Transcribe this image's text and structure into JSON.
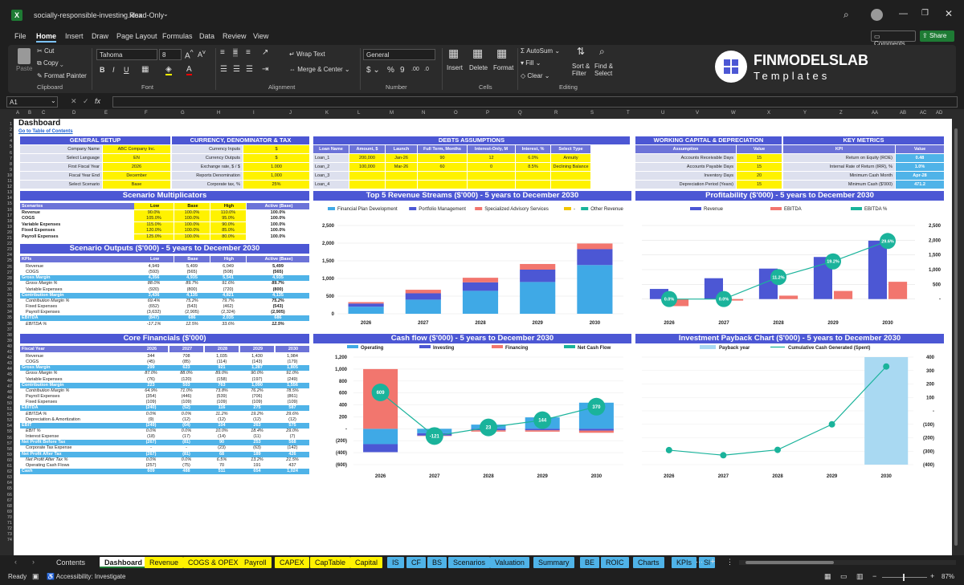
{
  "window": {
    "filename": "socially-responsible-investing.xlsx",
    "mode": "Read-Only",
    "comments": "Comments",
    "share": "Share"
  },
  "menu": [
    "File",
    "Home",
    "Insert",
    "Draw",
    "Page Layout",
    "Formulas",
    "Data",
    "Review",
    "View"
  ],
  "ribbon": {
    "paste": "Paste",
    "cut": "Cut",
    "copy": "Copy",
    "format_painter": "Format Painter",
    "clipboard": "Clipboard",
    "font_name": "Tahoma",
    "font_size": "8",
    "font": "Font",
    "wrap_text": "Wrap Text",
    "merge_center": "Merge & Center",
    "alignment": "Alignment",
    "number_format": "General",
    "number": "Number",
    "insert": "Insert",
    "delete": "Delete",
    "format": "Format",
    "cells": "Cells",
    "autosum": "AutoSum",
    "fill": "Fill",
    "clear": "Clear",
    "sort_filter": "Sort & Filter",
    "find_select": "Find & Select",
    "editing": "Editing",
    "brand_main": "FINMODELSLAB",
    "brand_sub": "Templates"
  },
  "formula": {
    "cell_ref": "A1",
    "fx": "fx"
  },
  "columns": [
    "A",
    "B",
    "C",
    "D",
    "E",
    "F",
    "G",
    "H",
    "I",
    "J",
    "K",
    "L",
    "M",
    "N",
    "O",
    "P",
    "Q",
    "R",
    "S",
    "T",
    "U",
    "V",
    "W",
    "X",
    "Y",
    "Z",
    "AA",
    "AB",
    "AC",
    "AD"
  ],
  "rows": [
    "1",
    "2",
    "3",
    "4",
    "5",
    "6",
    "7",
    "8",
    "9",
    "10",
    "11",
    "12",
    "13",
    "14",
    "15",
    "16",
    "17",
    "18",
    "19",
    "20",
    "21",
    "22",
    "23",
    "24",
    "25",
    "26",
    "27",
    "28",
    "29",
    "30",
    "31",
    "32",
    "33",
    "34",
    "35",
    "36",
    "37",
    "38",
    "39",
    "40",
    "41",
    "42",
    "43",
    "44",
    "45",
    "46",
    "47",
    "48",
    "49",
    "50",
    "51",
    "52",
    "53",
    "54",
    "55",
    "56",
    "57",
    "58",
    "59",
    "60",
    "61",
    "62",
    "63",
    "64",
    "65",
    "66",
    "67",
    "68",
    "69",
    "70",
    "71",
    "72",
    "73",
    "74"
  ],
  "sheet": {
    "title": "Dashboard",
    "toc_link": "Go to Table of Contents",
    "general_setup": {
      "header": "GENERAL SETUP",
      "items": [
        {
          "label": "Company Name",
          "value": "ABC Company Inc."
        },
        {
          "label": "Select Language",
          "value": "EN"
        },
        {
          "label": "First Fiscal Year",
          "value": "2026"
        },
        {
          "label": "Fiscal Year End",
          "value": "December"
        },
        {
          "label": "Select Scenario",
          "value": "Base"
        }
      ]
    },
    "currency": {
      "header": "CURRENCY, DENOMINATOR & TAX",
      "items": [
        {
          "label": "Currency Inputs",
          "value": "$"
        },
        {
          "label": "Currency Outputs",
          "value": "$"
        },
        {
          "label": "Exchange rate, $ / $",
          "value": "1.000"
        },
        {
          "label": "Reports Denomination",
          "value": "1,000"
        },
        {
          "label": "Corporate tax, %",
          "value": "25%"
        }
      ]
    },
    "debts": {
      "header": "DEBTS ASSUMPTIONS",
      "columns": [
        "Loan Name",
        "Amount, $",
        "Launch",
        "Full Term, Months",
        "Interest-Only, M",
        "Interest, %",
        "Select Type"
      ],
      "rows": [
        [
          "Loan_1",
          "200,000",
          "Jan-26",
          "90",
          "12",
          "6.0%",
          "Annuity"
        ],
        [
          "Loan_2",
          "100,000",
          "Mar-26",
          "60",
          "0",
          "8.5%",
          "Declining Balance"
        ],
        [
          "Loan_3",
          "",
          "",
          "",
          "",
          "",
          ""
        ],
        [
          "Loan_4",
          "",
          "",
          "",
          "",
          "",
          ""
        ]
      ]
    },
    "working_capital": {
      "header": "WORKING CAPITAL & DEPRECIATION",
      "col1": "Assumption",
      "col2": "Value",
      "items": [
        {
          "label": "Accounts Receivable Days",
          "value": "15"
        },
        {
          "label": "Accounts Payable Days",
          "value": "15"
        },
        {
          "label": "Inventory Days",
          "value": "20"
        },
        {
          "label": "Depreciation Period (Years)",
          "value": "15"
        }
      ]
    },
    "key_metrics": {
      "header": "KEY METRICS",
      "col1": "KPI",
      "col2": "Value",
      "items": [
        {
          "label": "Return on Equity (ROE)",
          "value": "0.48"
        },
        {
          "label": "Internal Rate of Return (IRR), %",
          "value": "1.0%"
        },
        {
          "label": "Minimum Cash Month",
          "value": "Apr-28"
        },
        {
          "label": "Minimum Cash ($'000)",
          "value": "471.2"
        }
      ]
    },
    "scenario_mult": {
      "header": "Scenario Multiplicators",
      "columns": [
        "Scenarios",
        "Low",
        "Base",
        "High",
        "Active (Base)"
      ],
      "rows": [
        [
          "Revenue",
          "90.0%",
          "100.0%",
          "110.0%",
          "100.0%"
        ],
        [
          "COGS",
          "105.0%",
          "100.0%",
          "95.0%",
          "100.0%"
        ],
        [
          "Variable Expenses",
          "115.0%",
          "100.0%",
          "90.0%",
          "100.0%"
        ],
        [
          "Fixed Expenses",
          "120.0%",
          "100.0%",
          "85.0%",
          "100.0%"
        ],
        [
          "Payroll Expenses",
          "125.0%",
          "100.0%",
          "80.0%",
          "100.0%"
        ]
      ]
    },
    "scenario_out": {
      "header": "Scenario Outputs ($'000) - 5 years to December 2030",
      "columns": [
        "KPIs",
        "Low",
        "Base",
        "High",
        "Active (Base)"
      ],
      "rows": [
        {
          "k": "Revenue",
          "v": [
            "4,949",
            "5,499",
            "6,049",
            "5,499"
          ],
          "t": "n"
        },
        {
          "k": "COGS",
          "v": [
            "(593)",
            "(565)",
            "(508)",
            "(565)"
          ],
          "t": "n"
        },
        {
          "k": "Gross Margin",
          "v": [
            "4,356",
            "4,935",
            "5,541",
            "4,935"
          ],
          "t": "h"
        },
        {
          "k": "Gross Margin %",
          "v": [
            "88.0%",
            "89.7%",
            "91.6%",
            "89.7%"
          ],
          "t": "i"
        },
        {
          "k": "Variable Expenses",
          "v": [
            "(920)",
            "(800)",
            "(720)",
            "(800)"
          ],
          "t": "n"
        },
        {
          "k": "Contribution Margin",
          "v": [
            "3,436",
            "4,135",
            "4,821",
            "4,135"
          ],
          "t": "h"
        },
        {
          "k": "Contribution Margin %",
          "v": [
            "69.4%",
            "75.2%",
            "79.7%",
            "75.2%"
          ],
          "t": "i"
        },
        {
          "k": "Fixed Expenses",
          "v": [
            "(652)",
            "(543)",
            "(462)",
            "(543)"
          ],
          "t": "n"
        },
        {
          "k": "Payroll Expenses",
          "v": [
            "(3,632)",
            "(2,905)",
            "(2,324)",
            "(2,905)"
          ],
          "t": "n"
        },
        {
          "k": "EBITDA",
          "v": [
            "(847)",
            "686",
            "2,035",
            "686"
          ],
          "t": "h"
        },
        {
          "k": "EBITDA %",
          "v": [
            "-17.1%",
            "12.5%",
            "33.6%",
            "12.5%"
          ],
          "t": "i"
        }
      ]
    },
    "core": {
      "header": "Core Financials ($'000)",
      "columns": [
        "Fiscal Year",
        "2026",
        "2027",
        "2028",
        "2029",
        "2030"
      ],
      "rows": [
        {
          "k": "Revenue",
          "v": [
            "344",
            "708",
            "1,035",
            "1,430",
            "1,984"
          ],
          "t": "n"
        },
        {
          "k": "COGS",
          "v": [
            "(45)",
            "(85)",
            "(114)",
            "(143)",
            "(179)"
          ],
          "t": "n"
        },
        {
          "k": "Gross Margin",
          "v": [
            "299",
            "623",
            "921",
            "1,287",
            "1,805"
          ],
          "t": "h"
        },
        {
          "k": "Gross Margin %",
          "v": [
            "87.0%",
            "88.0%",
            "89.0%",
            "90.0%",
            "91.0%"
          ],
          "t": "i"
        },
        {
          "k": "Variable Expenses",
          "v": [
            "(76)",
            "(120)",
            "(158)",
            "(197)",
            "(249)"
          ],
          "t": "n"
        },
        {
          "k": "Contribution Margin",
          "v": [
            "223",
            "503",
            "763",
            "1,090",
            "1,556"
          ],
          "t": "h"
        },
        {
          "k": "Contribution Margin %",
          "v": [
            "64.9%",
            "71.0%",
            "73.8%",
            "76.2%",
            "78.5%"
          ],
          "t": "i"
        },
        {
          "k": "Payroll Expenses",
          "v": [
            "(354)",
            "(446)",
            "(539)",
            "(706)",
            "(861)"
          ],
          "t": "n"
        },
        {
          "k": "Fixed Expenses",
          "v": [
            "(109)",
            "(109)",
            "(109)",
            "(109)",
            "(109)"
          ],
          "t": "n"
        },
        {
          "k": "EBITDA",
          "v": [
            "(240)",
            "(52)",
            "116",
            "275",
            "587"
          ],
          "t": "h"
        },
        {
          "k": "EBITDA %",
          "v": [
            "0.0%",
            "0.0%",
            "11.2%",
            "19.2%",
            "29.6%"
          ],
          "t": "i"
        },
        {
          "k": "Depreciation & Amortization",
          "v": [
            "(9)",
            "(12)",
            "(12)",
            "(12)",
            "(12)"
          ],
          "t": "n"
        },
        {
          "k": "EBIT",
          "v": [
            "(249)",
            "(64)",
            "104",
            "263",
            "575"
          ],
          "t": "h"
        },
        {
          "k": "EBIT %",
          "v": [
            "0.0%",
            "0.0%",
            "10.0%",
            "18.4%",
            "29.0%"
          ],
          "t": "i"
        },
        {
          "k": "Interest Expense",
          "v": [
            "(18)",
            "(17)",
            "(14)",
            "(11)",
            "(7)"
          ],
          "t": "n"
        },
        {
          "k": "Net Profit Before Tax",
          "v": [
            "(267)",
            "(81)",
            "90",
            "253",
            "568"
          ],
          "t": "h"
        },
        {
          "k": "Corporate Tax Expense",
          "v": [
            "-",
            "-",
            "(23)",
            "(63)",
            "(142)"
          ],
          "t": "n"
        },
        {
          "k": "Net Profit After Tax",
          "v": [
            "(267)",
            "(81)",
            "68",
            "189",
            "426"
          ],
          "t": "h"
        },
        {
          "k": "Net Profit After Tax %",
          "v": [
            "0.0%",
            "0.0%",
            "6.5%",
            "13.2%",
            "21.5%"
          ],
          "t": "i"
        },
        {
          "k": "Operating Cash Flows",
          "v": [
            "(257)",
            "(75)",
            "70",
            "191",
            "437"
          ],
          "t": "n"
        },
        {
          "k": "Cash",
          "v": [
            "609",
            "488",
            "511",
            "654",
            "1,024"
          ],
          "t": "h"
        }
      ]
    }
  },
  "charts": {
    "revenue": {
      "title": "Top 5 Revenue Streams ($'000) - 5 years to December 2030"
    },
    "profit": {
      "title": "Profitability ($'000) - 5 years to December 2030"
    },
    "cash": {
      "title": "Cash flow ($'000) - 5 years to December 2030"
    },
    "payback": {
      "title": "Investment Payback Chart ($'000) - 5 years to December 2030"
    }
  },
  "chart_data": [
    {
      "type": "bar",
      "title": "Top 5 Revenue Streams ($'000) - 5 years to December 2030",
      "categories": [
        "2026",
        "2027",
        "2028",
        "2029",
        "2030"
      ],
      "ylim": [
        0,
        2500
      ],
      "yticks": [
        "0",
        "500",
        "1,000",
        "1,500",
        "2,000",
        "2,500"
      ],
      "series": [
        {
          "name": "Financial Plan Development",
          "values": [
            200,
            400,
            650,
            900,
            1380
          ],
          "color": "#3fa9e6"
        },
        {
          "name": "Portfolio Management",
          "values": [
            90,
            180,
            240,
            350,
            450
          ],
          "color": "#4c57d4"
        },
        {
          "name": "Specialized Advisory Services",
          "values": [
            40,
            100,
            130,
            160,
            160
          ],
          "color": "#f2766e"
        },
        {
          "name": "-",
          "values": [
            0,
            0,
            0,
            0,
            0
          ],
          "color": "#f2c500"
        },
        {
          "name": "Other Revenue",
          "values": [
            0,
            0,
            0,
            0,
            0
          ],
          "color": "#1ab39b"
        }
      ]
    },
    {
      "type": "bar",
      "title": "Profitability ($'000) - 5 years to December 2030",
      "categories": [
        "2026",
        "2027",
        "2028",
        "2029",
        "2030"
      ],
      "ylim": [
        -500,
        2500
      ],
      "yticks": [
        "-",
        "500",
        "1,000",
        "1,500",
        "2,000",
        "2,500"
      ],
      "y2ticks": [
        "-",
        "5.0%",
        "10.0%",
        "15.0%",
        "20.0%",
        "25.0%",
        "30.0%"
      ],
      "series": [
        {
          "name": "Revenue",
          "values": [
            344,
            708,
            1035,
            1430,
            1984
          ],
          "color": "#4c57d4"
        },
        {
          "name": "EBITDA",
          "values": [
            -240,
            -52,
            116,
            275,
            587
          ],
          "color": "#f2766e"
        },
        {
          "name": "EBITDA %",
          "values": [
            0.0,
            0.0,
            11.2,
            19.2,
            29.6
          ],
          "labels": [
            "0.0%",
            "0.0%",
            "11.2%",
            "19.2%",
            "29.6%"
          ],
          "color": "#1ab39b"
        }
      ]
    },
    {
      "type": "bar",
      "title": "Cash flow ($'000) - 5 years to December 2030",
      "categories": [
        "2026",
        "2027",
        "2028",
        "2029",
        "2030"
      ],
      "ylim": [
        -600,
        1200
      ],
      "yticks": [
        "(600)",
        "(400)",
        "(200)",
        "-",
        "200",
        "400",
        "600",
        "800",
        "1,000",
        "1,200"
      ],
      "series": [
        {
          "name": "Operating",
          "values": [
            -257,
            -75,
            70,
            191,
            437
          ],
          "color": "#3fa9e6"
        },
        {
          "name": "Investing",
          "values": [
            -134,
            -40,
            -25,
            -25,
            -30
          ],
          "color": "#4c57d4"
        },
        {
          "name": "Financing",
          "values": [
            1000,
            -6,
            -22,
            -23,
            -37
          ],
          "color": "#f2766e"
        },
        {
          "name": "Net Cash Flow",
          "values": [
            609,
            -121,
            23,
            144,
            370
          ],
          "labels": [
            "609",
            "-121",
            "23",
            "144",
            "370"
          ],
          "color": "#1ab39b"
        }
      ]
    },
    {
      "type": "line",
      "title": "Investment Payback Chart ($'000) - 5 years to December 2030",
      "categories": [
        "2026",
        "2027",
        "2028",
        "2029",
        "2030"
      ],
      "ylim": [
        -400,
        400
      ],
      "yticks": [
        "(400)",
        "(300)",
        "(200)",
        "(100)",
        "-",
        "100",
        "200",
        "300",
        "400"
      ],
      "series": [
        {
          "name": "Payback year",
          "values": [
            0,
            0,
            0,
            0,
            1
          ],
          "color": "#a9d9f2"
        },
        {
          "name": "Cumulative Cash Generated (Spent)",
          "values": [
            -292,
            -330,
            -290,
            -100,
            330
          ],
          "color": "#1ab39b"
        }
      ]
    }
  ],
  "tabs": [
    {
      "label": "Contents",
      "style": "n"
    },
    {
      "label": "Dashboard",
      "style": "a"
    },
    {
      "label": "Revenue",
      "style": "y"
    },
    {
      "label": "COGS & OPEX",
      "style": "y"
    },
    {
      "label": "Payroll",
      "style": "y"
    },
    {
      "label": "CAPEX",
      "style": "y"
    },
    {
      "label": "CapTable",
      "style": "y"
    },
    {
      "label": "Capital",
      "style": "y"
    },
    {
      "label": "IS",
      "style": "b"
    },
    {
      "label": "CF",
      "style": "b"
    },
    {
      "label": "BS",
      "style": "b"
    },
    {
      "label": "Scenarios",
      "style": "b"
    },
    {
      "label": "Valuation",
      "style": "b"
    },
    {
      "label": "Summary",
      "style": "b"
    },
    {
      "label": "BE",
      "style": "b"
    },
    {
      "label": "ROIC",
      "style": "b"
    },
    {
      "label": "Charts",
      "style": "b"
    },
    {
      "label": "KPIs",
      "style": "b"
    },
    {
      "label": "Sl",
      "style": "b"
    }
  ],
  "status": {
    "ready": "Ready",
    "accessibility": "Accessibility: Investigate",
    "zoom": "87%"
  }
}
